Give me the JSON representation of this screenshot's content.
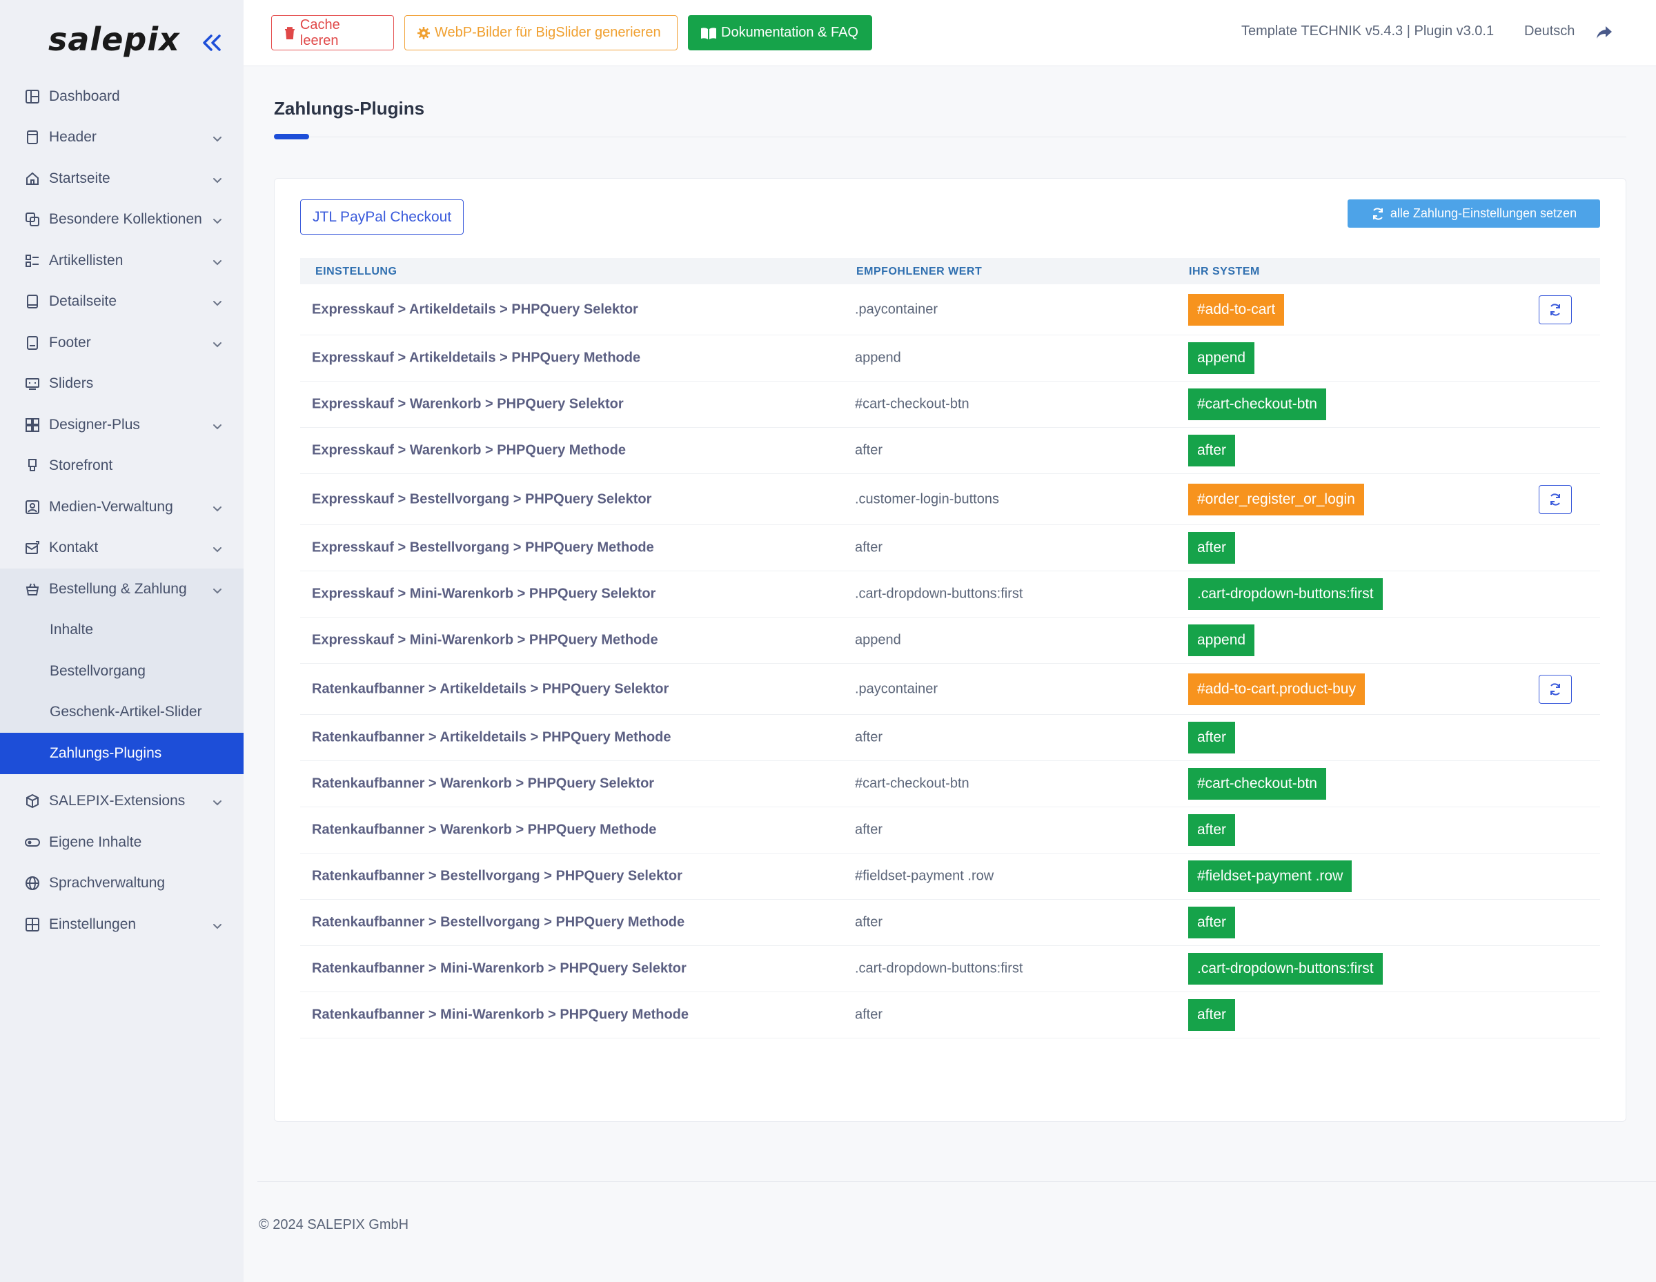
{
  "brand": "salepix",
  "topbar": {
    "cache_label": "Cache leeren",
    "webp_label": "WebP-Bilder für BigSlider generieren",
    "docs_label": "Dokumentation & FAQ",
    "version": "Template TECHNIK v5.4.3 | Plugin v3.0.1",
    "language": "Deutsch"
  },
  "sidebar": {
    "items": [
      {
        "label": "Dashboard",
        "icon": "dashboard-icon",
        "chevron": false
      },
      {
        "label": "Header",
        "icon": "header-icon",
        "chevron": true
      },
      {
        "label": "Startseite",
        "icon": "home-icon",
        "chevron": true
      },
      {
        "label": "Besondere Kollektionen",
        "icon": "collections-icon",
        "chevron": true
      },
      {
        "label": "Artikellisten",
        "icon": "list-icon",
        "chevron": true
      },
      {
        "label": "Detailseite",
        "icon": "detail-icon",
        "chevron": true
      },
      {
        "label": "Footer",
        "icon": "footer-icon",
        "chevron": true
      },
      {
        "label": "Sliders",
        "icon": "slider-icon",
        "chevron": false
      },
      {
        "label": "Designer-Plus",
        "icon": "designer-icon",
        "chevron": true
      },
      {
        "label": "Storefront",
        "icon": "storefront-icon",
        "chevron": false
      },
      {
        "label": "Medien-Verwaltung",
        "icon": "media-icon",
        "chevron": true
      },
      {
        "label": "Kontakt",
        "icon": "contact-icon",
        "chevron": true
      },
      {
        "label": "Bestellung & Zahlung",
        "icon": "basket-icon",
        "chevron": true
      }
    ],
    "sub_items": [
      "Inhalte",
      "Bestellvorgang",
      "Geschenk-Artikel-Slider",
      "Zahlungs-Plugins"
    ],
    "after_items": [
      {
        "label": "SALEPIX-Extensions",
        "icon": "extensions-icon",
        "chevron": true
      },
      {
        "label": "Eigene Inhalte",
        "icon": "toggle-icon",
        "chevron": false
      },
      {
        "label": "Sprachverwaltung",
        "icon": "globe-icon",
        "chevron": false
      },
      {
        "label": "Einstellungen",
        "icon": "settings-icon",
        "chevron": true
      }
    ]
  },
  "main": {
    "title": "Zahlungs-Plugins",
    "plugin_tab": "JTL PayPal Checkout",
    "set_all_label": "alle Zahlung-Einstellungen setzen",
    "columns": [
      "EINSTELLUNG",
      "EMPFOHLENER WERT",
      "IHR SYSTEM"
    ],
    "rows": [
      {
        "setting": "Expresskauf > Artikeldetails > PHPQuery Selektor",
        "recommended": ".paycontainer",
        "system": "#add-to-cart",
        "status": "warn"
      },
      {
        "setting": "Expresskauf > Artikeldetails > PHPQuery Methode",
        "recommended": "append",
        "system": "append",
        "status": "ok"
      },
      {
        "setting": "Expresskauf > Warenkorb > PHPQuery Selektor",
        "recommended": "#cart-checkout-btn",
        "system": "#cart-checkout-btn",
        "status": "ok"
      },
      {
        "setting": "Expresskauf > Warenkorb > PHPQuery Methode",
        "recommended": "after",
        "system": "after",
        "status": "ok"
      },
      {
        "setting": "Expresskauf > Bestellvorgang > PHPQuery Selektor",
        "recommended": ".customer-login-buttons",
        "system": "#order_register_or_login",
        "status": "warn"
      },
      {
        "setting": "Expresskauf > Bestellvorgang > PHPQuery Methode",
        "recommended": "after",
        "system": "after",
        "status": "ok"
      },
      {
        "setting": "Expresskauf > Mini-Warenkorb > PHPQuery Selektor",
        "recommended": ".cart-dropdown-buttons:first",
        "system": ".cart-dropdown-buttons:first",
        "status": "ok"
      },
      {
        "setting": "Expresskauf > Mini-Warenkorb > PHPQuery Methode",
        "recommended": "append",
        "system": "append",
        "status": "ok"
      },
      {
        "setting": "Ratenkaufbanner > Artikeldetails > PHPQuery Selektor",
        "recommended": ".paycontainer",
        "system": "#add-to-cart.product-buy",
        "status": "warn"
      },
      {
        "setting": "Ratenkaufbanner > Artikeldetails > PHPQuery Methode",
        "recommended": "after",
        "system": "after",
        "status": "ok"
      },
      {
        "setting": "Ratenkaufbanner > Warenkorb > PHPQuery Selektor",
        "recommended": "#cart-checkout-btn",
        "system": "#cart-checkout-btn",
        "status": "ok"
      },
      {
        "setting": "Ratenkaufbanner > Warenkorb > PHPQuery Methode",
        "recommended": "after",
        "system": "after",
        "status": "ok"
      },
      {
        "setting": "Ratenkaufbanner > Bestellvorgang > PHPQuery Selektor",
        "recommended": "#fieldset-payment .row",
        "system": "#fieldset-payment .row",
        "status": "ok"
      },
      {
        "setting": "Ratenkaufbanner > Bestellvorgang > PHPQuery Methode",
        "recommended": "after",
        "system": "after",
        "status": "ok"
      },
      {
        "setting": "Ratenkaufbanner > Mini-Warenkorb > PHPQuery Selektor",
        "recommended": ".cart-dropdown-buttons:first",
        "system": ".cart-dropdown-buttons:first",
        "status": "ok"
      },
      {
        "setting": "Ratenkaufbanner > Mini-Warenkorb > PHPQuery Methode",
        "recommended": "after",
        "system": "after",
        "status": "ok"
      }
    ]
  },
  "footer": {
    "copyright": "© 2024 SALEPIX GmbH"
  },
  "colors": {
    "accent": "#1d4ed8",
    "ok": "#16a34a",
    "warn": "#f7931e",
    "danger": "#e04848",
    "info": "#4da3e8"
  }
}
